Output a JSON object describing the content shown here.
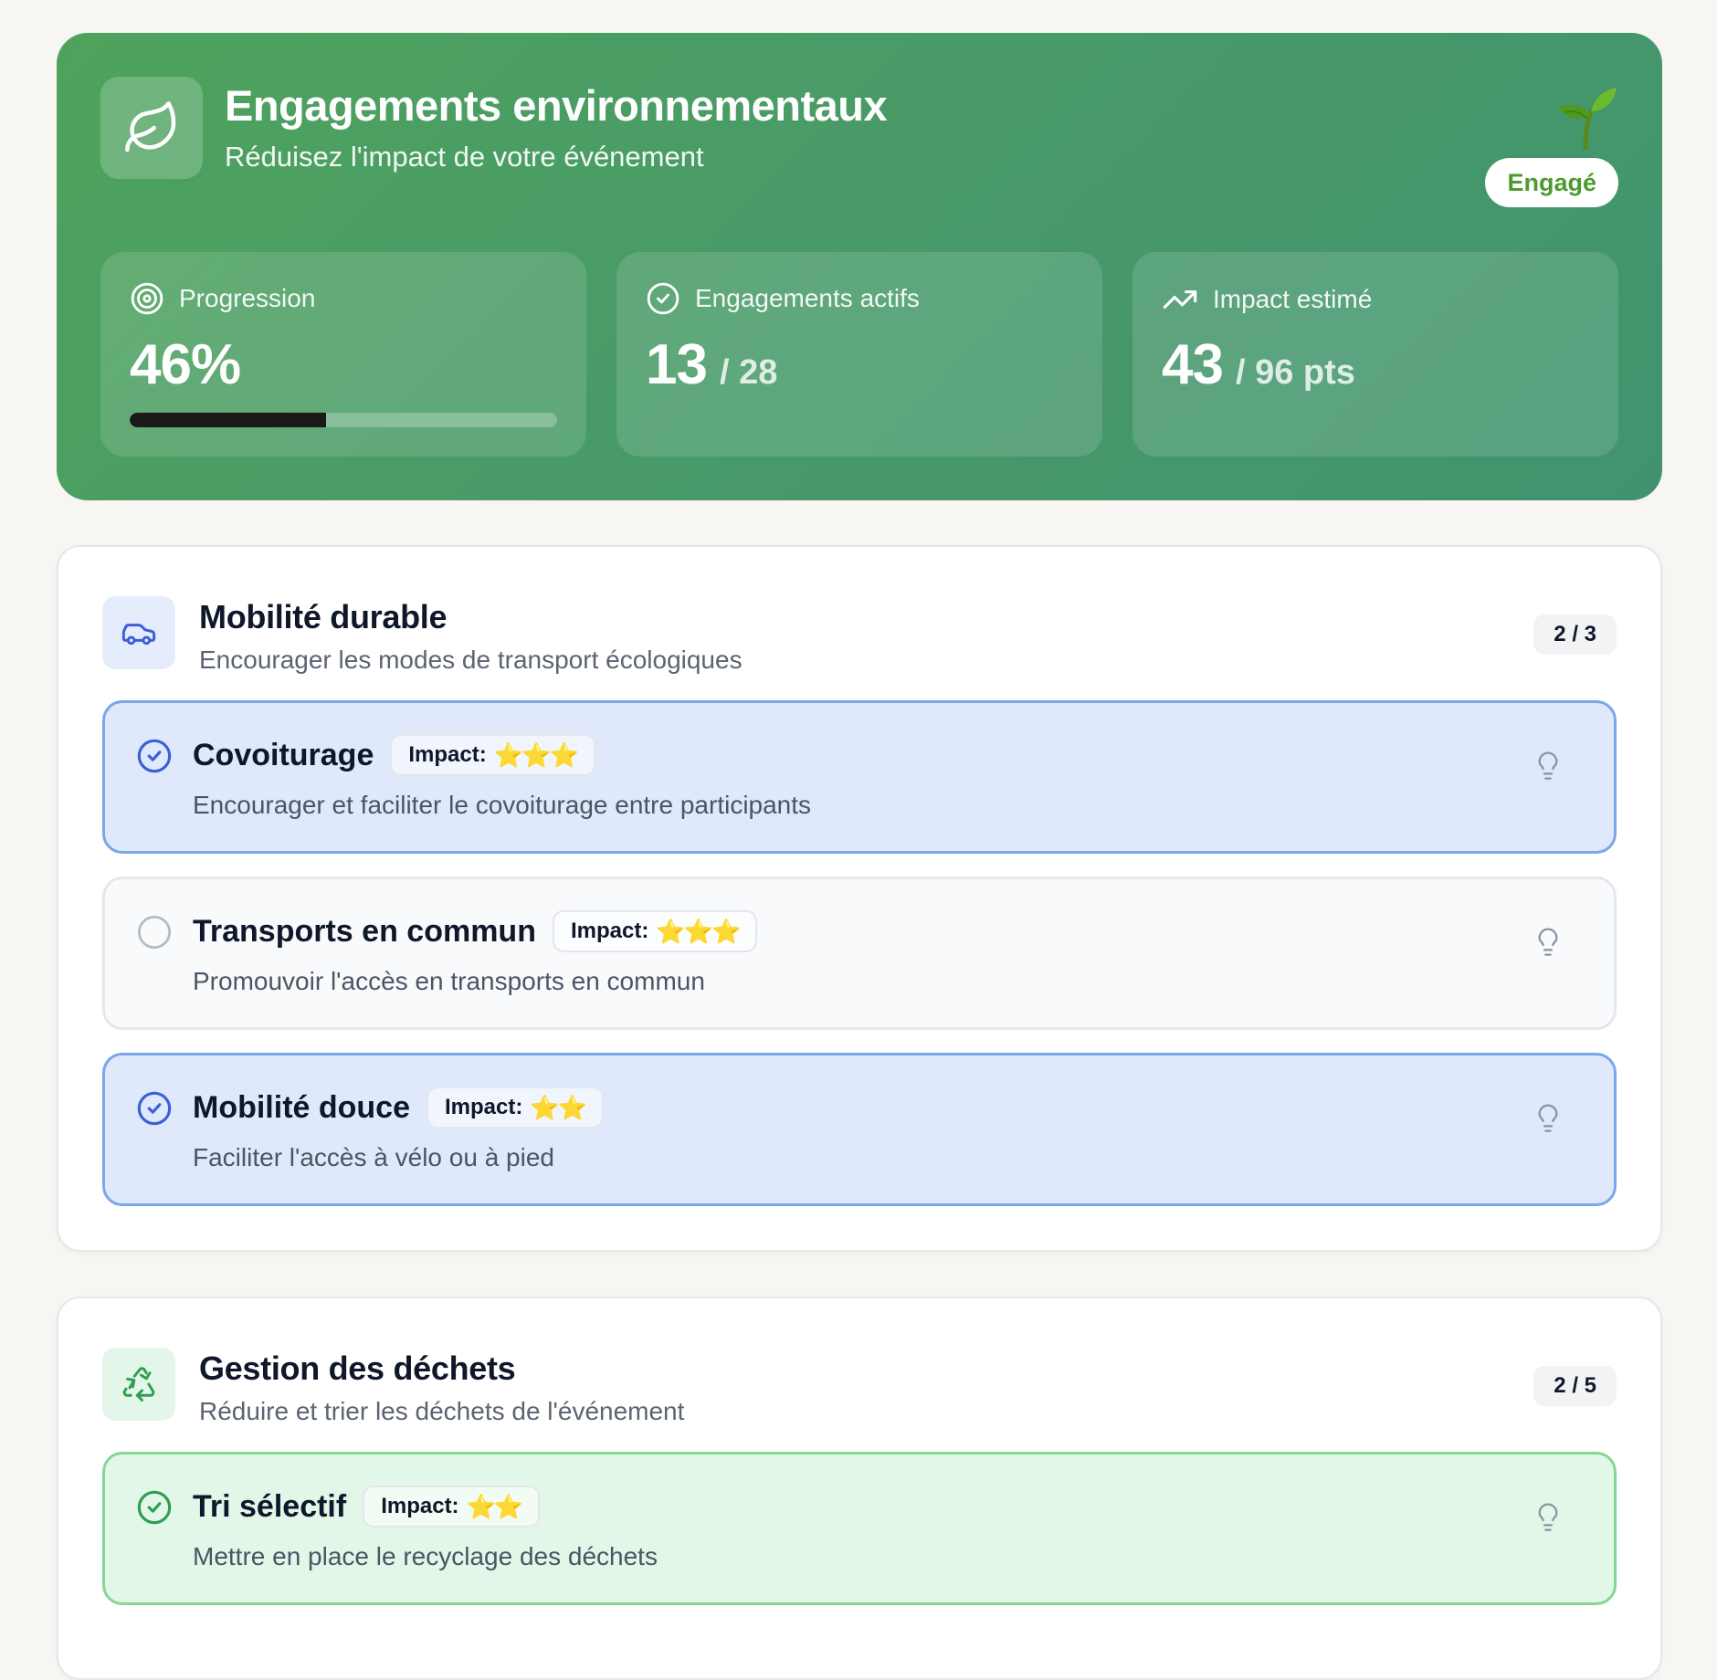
{
  "hero": {
    "title": "Engagements environnementaux",
    "subtitle": "Réduisez l'impact de votre événement",
    "badge": "Engagé",
    "icons": {
      "main": "leaf-icon",
      "decoration": "seedling-icon"
    },
    "stats": {
      "progression": {
        "label": "Progression",
        "value": "46%",
        "percent": 46,
        "icon": "target-icon"
      },
      "active": {
        "label": "Engagements actifs",
        "value": "13",
        "suffix": "/ 28",
        "icon": "check-circle-icon"
      },
      "impact": {
        "label": "Impact estimé",
        "value": "43",
        "suffix": "/ 96 pts",
        "icon": "trending-up-icon"
      }
    }
  },
  "categories": [
    {
      "title": "Mobilité durable",
      "description": "Encourager les modes de transport écologiques",
      "count": "2 / 3",
      "icon": "car-icon",
      "accent": "#3b5fd9",
      "icon_bg": "#e5edfd",
      "items": [
        {
          "title": "Covoiturage",
          "impact_label": "Impact:",
          "stars": "⭐⭐⭐",
          "rating": 3,
          "description": "Encourager et faciliter le covoiturage entre participants",
          "checked": true
        },
        {
          "title": "Transports en commun",
          "impact_label": "Impact:",
          "stars": "⭐⭐⭐",
          "rating": 3,
          "description": "Promouvoir l'accès en transports en commun",
          "checked": false
        },
        {
          "title": "Mobilité douce",
          "impact_label": "Impact:",
          "stars": "⭐⭐",
          "rating": 2,
          "description": "Faciliter l'accès à vélo ou à pied",
          "checked": true
        }
      ]
    },
    {
      "title": "Gestion des déchets",
      "description": "Réduire et trier les déchets de l'événement",
      "count": "2 / 5",
      "icon": "recycle-icon",
      "accent": "#2f9e52",
      "icon_bg": "#e4f6ea",
      "items": [
        {
          "title": "Tri sélectif",
          "impact_label": "Impact:",
          "stars": "⭐⭐",
          "rating": 2,
          "description": "Mettre en place le recyclage des déchets",
          "checked": true
        }
      ]
    }
  ],
  "colors": {
    "hero_start": "#4ea35c",
    "hero_end": "#41936e",
    "badge_text": "#4d9a2f",
    "blue_selected_bg": "#dfe9fb",
    "blue_selected_border": "#7aa6ea",
    "green_selected_bg": "#e2f7e7",
    "green_selected_border": "#84d797",
    "progress_fill": "#1a1a1a"
  }
}
